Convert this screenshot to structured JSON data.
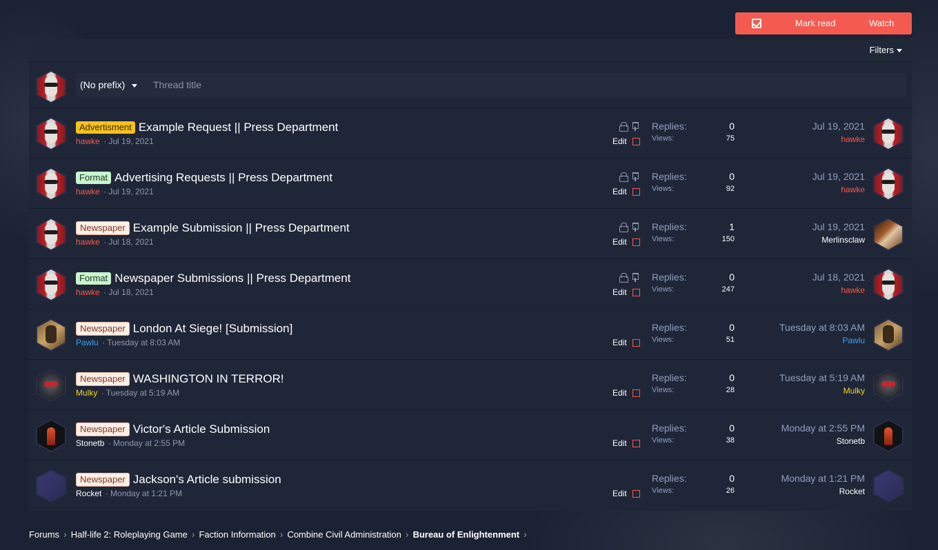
{
  "toolbar": {
    "mark_read_label": "Mark read",
    "watch_label": "Watch",
    "check_icon": "check-square-icon"
  },
  "filters": {
    "label": "Filters"
  },
  "new_thread": {
    "prefix": "(No prefix)",
    "title_placeholder": "Thread title"
  },
  "stats_labels": {
    "replies": "Replies:",
    "views": "Views:"
  },
  "edit_label": "Edit",
  "colors": {
    "accent": "#f45a4f",
    "bg": "#1b2233",
    "block": "#1f2638"
  },
  "threads": [
    {
      "prefix": "Advertisment",
      "prefix_kind": "advert",
      "title": "Example Request || Press Department",
      "author": "hawke",
      "author_color": "red",
      "date": "Jul 19, 2021",
      "locked": true,
      "replies": "0",
      "views": "75",
      "last_date": "Jul 19, 2021",
      "last_user": "hawke",
      "last_color": "red",
      "avatar": "hawke",
      "last_avatar": "hawke"
    },
    {
      "prefix": "Format",
      "prefix_kind": "format",
      "title": "Advertising Requests || Press Department",
      "author": "hawke",
      "author_color": "red",
      "date": "Jul 19, 2021",
      "locked": true,
      "replies": "0",
      "views": "92",
      "last_date": "Jul 19, 2021",
      "last_user": "hawke",
      "last_color": "red",
      "avatar": "hawke",
      "last_avatar": "hawke"
    },
    {
      "prefix": "Newspaper",
      "prefix_kind": "newspaper",
      "title": "Example Submission || Press Department",
      "author": "hawke",
      "author_color": "red",
      "date": "Jul 18, 2021",
      "locked": true,
      "replies": "1",
      "views": "150",
      "last_date": "Jul 19, 2021",
      "last_user": "Merlinsclaw",
      "last_color": "white",
      "avatar": "hawke",
      "last_avatar": "merlin"
    },
    {
      "prefix": "Format",
      "prefix_kind": "format",
      "title": "Newspaper Submissions || Press Department",
      "author": "hawke",
      "author_color": "red",
      "date": "Jul 18, 2021",
      "locked": true,
      "replies": "0",
      "views": "247",
      "last_date": "Jul 18, 2021",
      "last_user": "hawke",
      "last_color": "red",
      "avatar": "hawke",
      "last_avatar": "hawke"
    },
    {
      "prefix": "Newspaper",
      "prefix_kind": "newspaper",
      "title": "London At Siege! [Submission]",
      "author": "Pawlu",
      "author_color": "blue",
      "date": "Tuesday at 8:03 AM",
      "locked": false,
      "replies": "0",
      "views": "51",
      "last_date": "Tuesday at 8:03 AM",
      "last_user": "Pawlu",
      "last_color": "blue",
      "avatar": "pawlu",
      "last_avatar": "pawlu"
    },
    {
      "prefix": "Newspaper",
      "prefix_kind": "newspaper",
      "title": "WASHINGTON IN TERROR!",
      "author": "Mulky",
      "author_color": "yellow",
      "date": "Tuesday at 5:19 AM",
      "locked": false,
      "replies": "0",
      "views": "28",
      "last_date": "Tuesday at 5:19 AM",
      "last_user": "Mulky",
      "last_color": "yellow",
      "avatar": "mulky",
      "last_avatar": "mulky"
    },
    {
      "prefix": "Newspaper",
      "prefix_kind": "newspaper",
      "title": "Victor's Article Submission",
      "author": "Stonetb",
      "author_color": "white",
      "date": "Monday at 2:55 PM",
      "locked": false,
      "replies": "0",
      "views": "38",
      "last_date": "Monday at 2:55 PM",
      "last_user": "Stonetb",
      "last_color": "white",
      "avatar": "stonetb",
      "last_avatar": "stonetb"
    },
    {
      "prefix": "Newspaper",
      "prefix_kind": "newspaper",
      "title": "Jackson's Article submission",
      "author": "Rocket",
      "author_color": "white",
      "date": "Monday at 1:21 PM",
      "locked": false,
      "replies": "0",
      "views": "26",
      "last_date": "Monday at 1:21 PM",
      "last_user": "Rocket",
      "last_color": "white",
      "avatar": "rocket",
      "last_avatar": "rocket"
    }
  ],
  "breadcrumb": [
    "Forums",
    "Half-life 2: Roleplaying Game",
    "Faction Information",
    "Combine Civil Administration",
    "Bureau of Enlightenment"
  ]
}
